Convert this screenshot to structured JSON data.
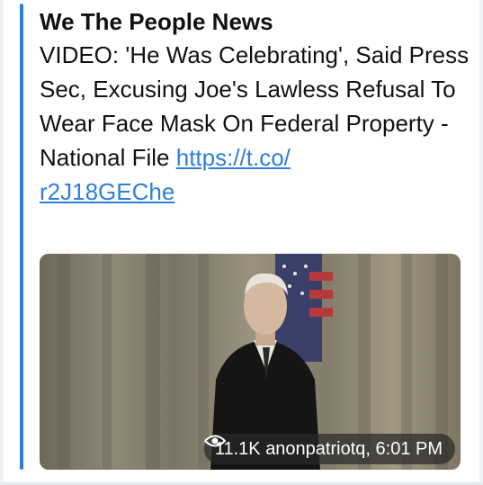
{
  "message": {
    "channel_name": "We The People News",
    "text": "VIDEO: 'He Was Celebrating', Said Press Sec, Excusing Joe's Lawless Refusal To Wear Face Mask On Federal Property - National File ",
    "link_line1": "https://t.co/",
    "link_line2": "r2J18GEChe",
    "views": "11.1K",
    "author": "anonpatriotq,",
    "time": "6:01 PM"
  },
  "icons": {
    "views": "eye-icon"
  },
  "colors": {
    "accent": "#2f7fd9",
    "link": "#2f7fd9",
    "text": "#111111"
  }
}
